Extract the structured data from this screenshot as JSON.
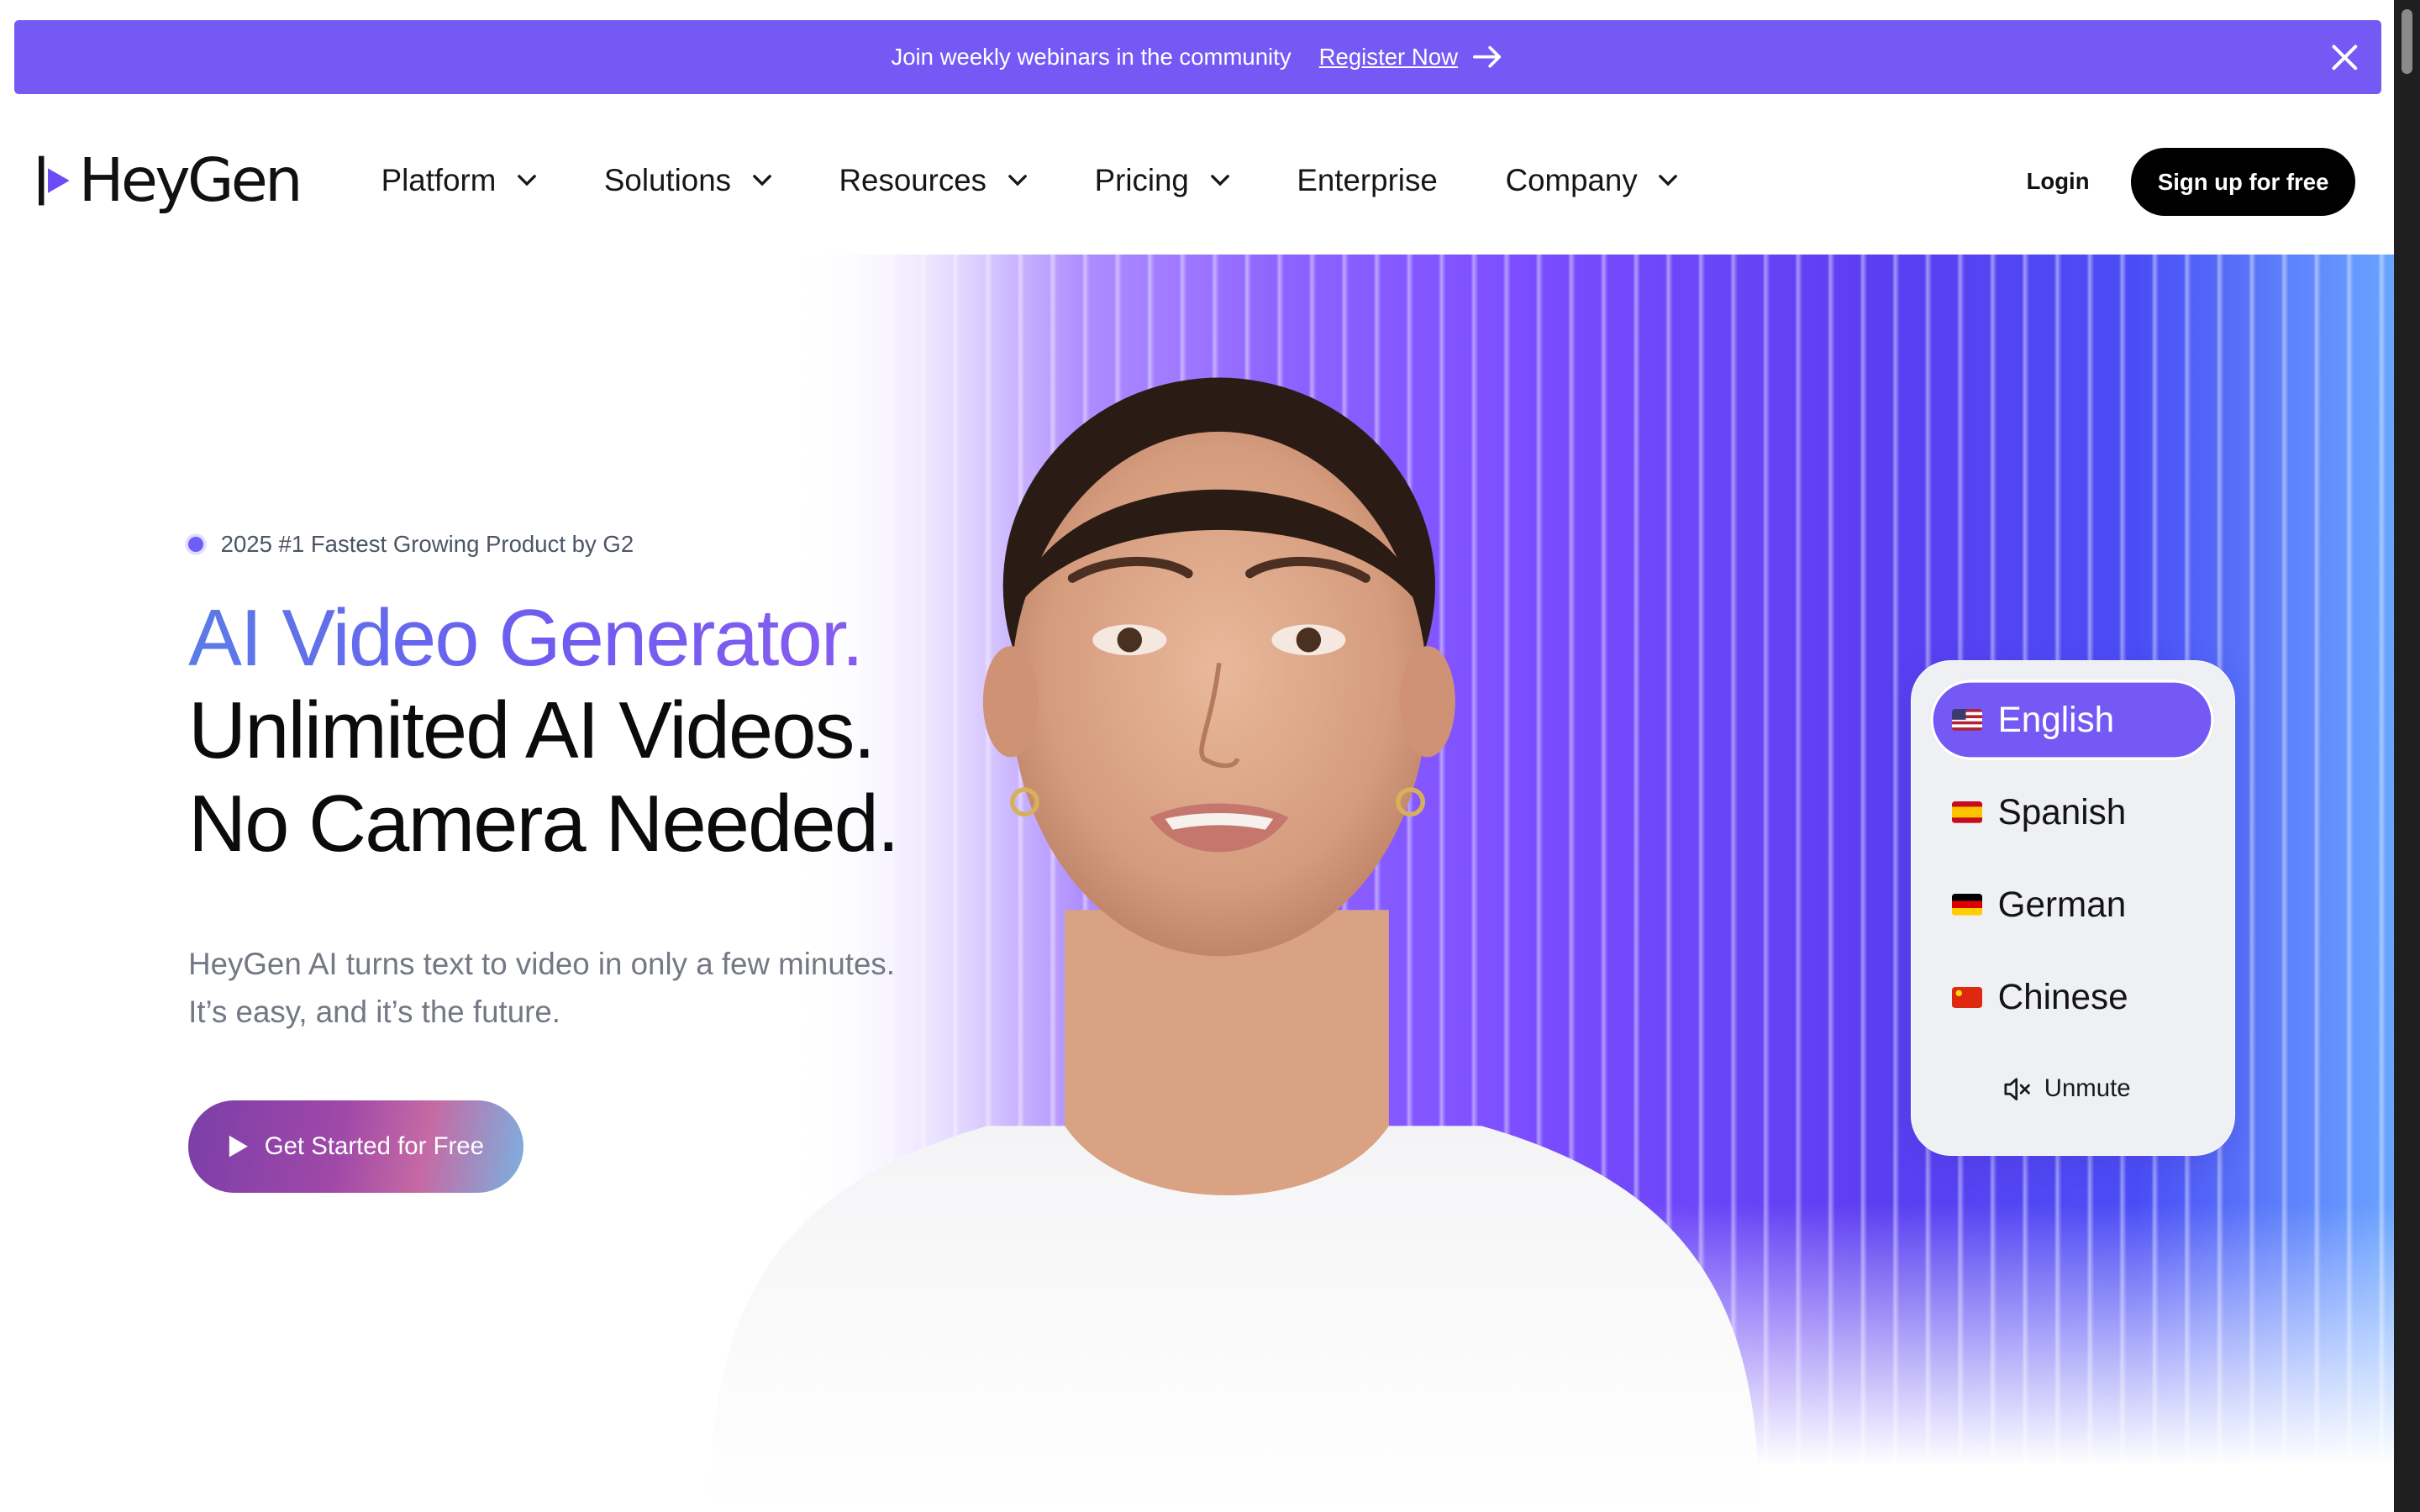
{
  "banner": {
    "message": "Join weekly webinars in the community",
    "link_label": "Register Now",
    "background": "#7559f5"
  },
  "nav": {
    "logo_text": "HeyGen",
    "items": [
      {
        "label": "Platform",
        "has_dropdown": true
      },
      {
        "label": "Solutions",
        "has_dropdown": true
      },
      {
        "label": "Resources",
        "has_dropdown": true
      },
      {
        "label": "Pricing",
        "has_dropdown": true
      },
      {
        "label": "Enterprise",
        "has_dropdown": false
      },
      {
        "label": "Company",
        "has_dropdown": true
      }
    ],
    "login_label": "Login",
    "signup_label": "Sign up for free"
  },
  "hero": {
    "badge": "2025 #1 Fastest Growing Product by G2",
    "headline_1": "AI Video Generator.",
    "headline_2": "Unlimited AI Videos.",
    "headline_3": "No Camera Needed.",
    "subtext_1": "HeyGen AI turns text to video in only a few minutes.",
    "subtext_2": "It’s easy, and it’s the future.",
    "cta_label": "Get Started for Free"
  },
  "language_selector": {
    "languages": [
      {
        "label": "English",
        "flag": "us-flag",
        "selected": true
      },
      {
        "label": "Spanish",
        "flag": "es-flag",
        "selected": false
      },
      {
        "label": "German",
        "flag": "de-flag",
        "selected": false
      },
      {
        "label": "Chinese",
        "flag": "cn-flag",
        "selected": false
      }
    ],
    "unmute_label": "Unmute"
  },
  "colors": {
    "accent": "#7559f5",
    "text_dark": "#0b0b0b",
    "text_muted": "#737884"
  }
}
